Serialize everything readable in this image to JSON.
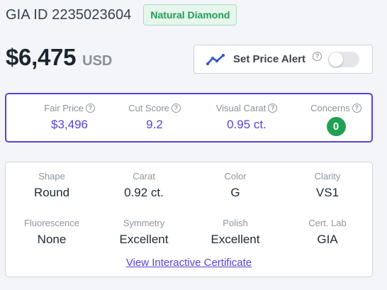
{
  "header": {
    "gia_id": "GIA ID 2235023604",
    "badge": "Natural Diamond"
  },
  "price": {
    "amount": "$6,475",
    "currency": "USD"
  },
  "price_alert": {
    "label": "Set Price Alert",
    "help": "?",
    "icon": "trend-line-icon",
    "enabled": false
  },
  "scores": [
    {
      "label": "Fair Price",
      "value": "$3,496",
      "help": "?"
    },
    {
      "label": "Cut Score",
      "value": "9.2",
      "help": "?"
    },
    {
      "label": "Visual Carat",
      "value": "0.95 ct.",
      "help": "?"
    },
    {
      "label": "Concerns",
      "value": "0",
      "help": "?"
    }
  ],
  "specs": [
    {
      "label": "Shape",
      "value": "Round"
    },
    {
      "label": "Carat",
      "value": "0.92 ct."
    },
    {
      "label": "Color",
      "value": "G"
    },
    {
      "label": "Clarity",
      "value": "VS1"
    },
    {
      "label": "Fluorescence",
      "value": "None"
    },
    {
      "label": "Symmetry",
      "value": "Excellent"
    },
    {
      "label": "Polish",
      "value": "Excellent"
    },
    {
      "label": "Cert. Lab",
      "value": "GIA"
    }
  ],
  "cert_link": "View Interactive Certificate",
  "colors": {
    "accent": "#5b41d6",
    "badge_green": "#1f9b54",
    "concern_green": "#20a052"
  }
}
